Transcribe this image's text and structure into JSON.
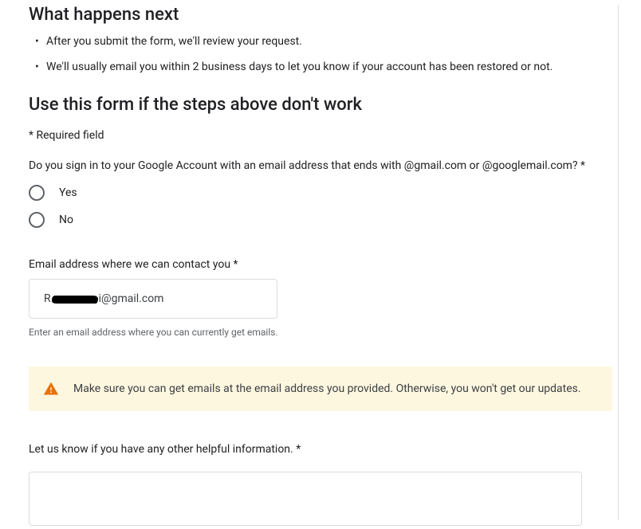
{
  "sections": {
    "whatNext": {
      "title": "What happens next",
      "bullets": [
        "After you submit the form, we'll review your request.",
        "We'll usually email you within 2 business days to let you know if your account has been restored or not."
      ]
    },
    "form": {
      "title": "Use this form if the steps above don't work",
      "requiredNote": "* Required field",
      "signInQuestion": "Do you sign in to your Google Account with an email address that ends with @gmail.com or @googlemail.com? *",
      "radioOptions": {
        "yes": "Yes",
        "no": "No"
      },
      "emailField": {
        "label": "Email address where we can contact you *",
        "prefix": "R",
        "suffix": "i@gmail.com",
        "helper": "Enter an email address where you can currently get emails."
      },
      "alert": "Make sure you can get emails at the email address you provided. Otherwise, you won't get our updates.",
      "otherInfo": {
        "label": "Let us know if you have any other helpful information. *",
        "value": ""
      }
    }
  }
}
